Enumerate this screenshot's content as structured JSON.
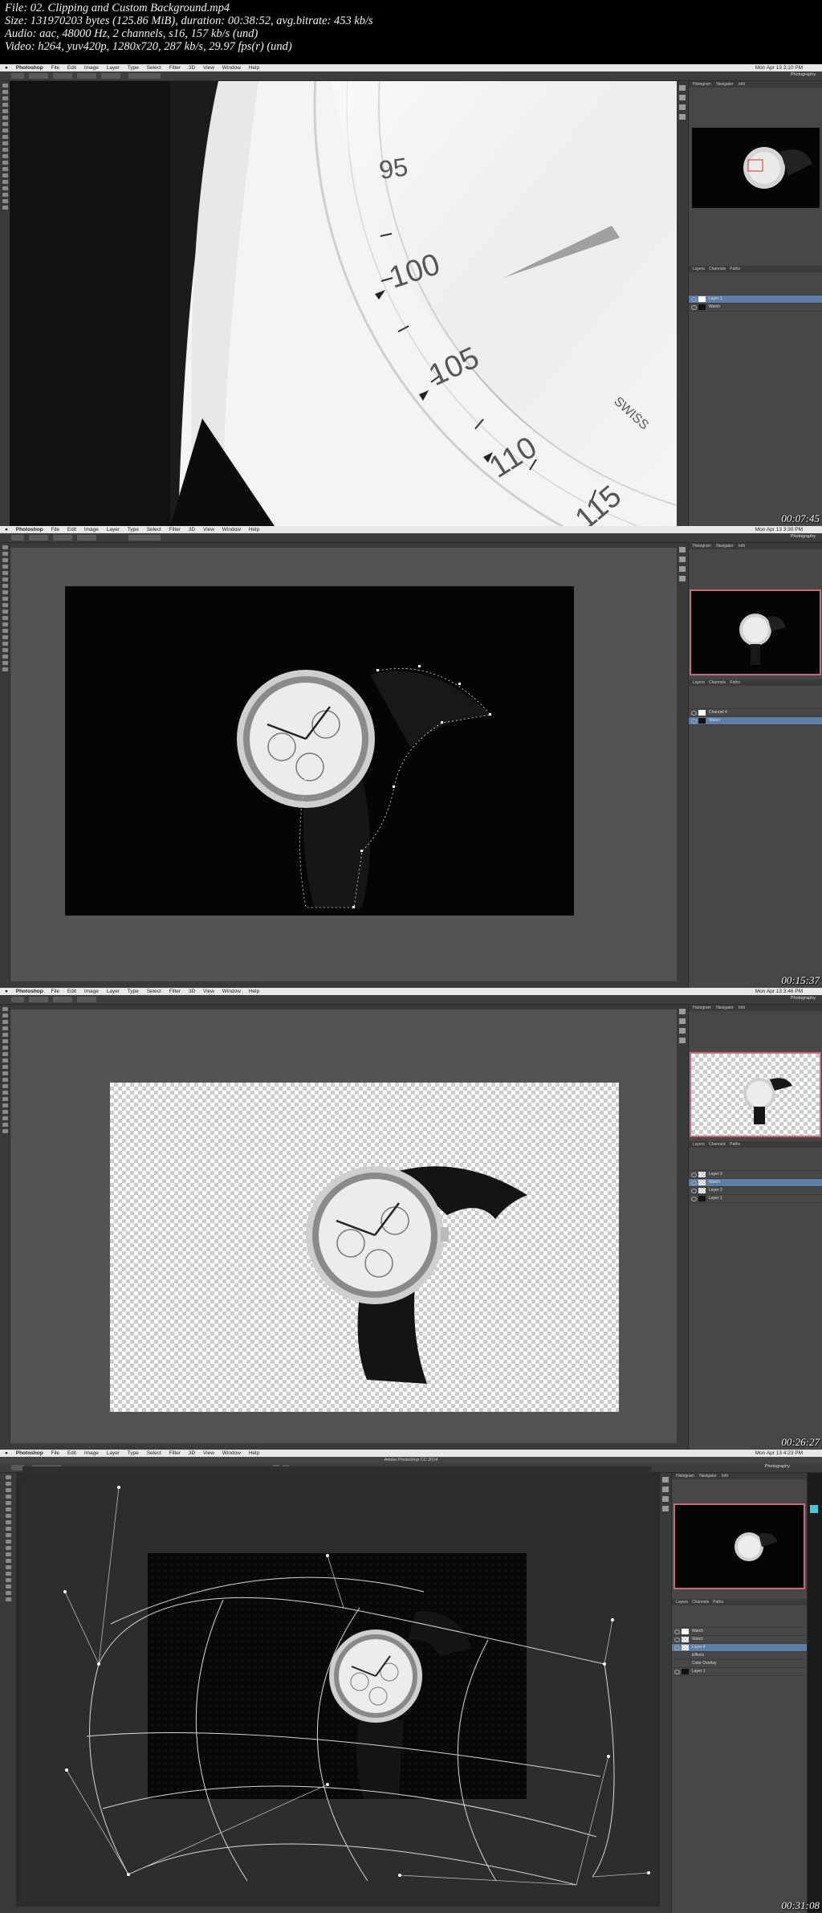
{
  "header": {
    "line1": "File: 02. Clipping and Custom Background.mp4",
    "line2": "Size: 131970203 bytes (125.86 MiB), duration: 00:38:52, avg.bitrate: 453 kb/s",
    "line3": "Audio: aac, 48000 Hz, 2 channels, s16, 157 kb/s (und)",
    "line4": "Video: h264, yuv420p, 1280x720, 287 kb/s, 29.97 fps(r) (und)"
  },
  "menubar": {
    "app": "Photoshop",
    "items": [
      "File",
      "Edit",
      "Image",
      "Layer",
      "Type",
      "Select",
      "Filter",
      "3D",
      "View",
      "Window",
      "Help"
    ]
  },
  "frames": [
    {
      "timestamp": "00:07:45",
      "clock": "Mon Apr 13  3:10 PM",
      "workspace": "Photography",
      "panel_tabs": [
        "Histogram",
        "Navigator",
        "Info"
      ],
      "layers": [
        {
          "name": "Layer 1",
          "active": true
        },
        {
          "name": "Watch",
          "active": false
        }
      ],
      "dial_numbers": [
        "95",
        "100",
        "105",
        "110",
        "115"
      ],
      "dial_text": "SWISS"
    },
    {
      "timestamp": "00:15:37",
      "clock": "Mon Apr 13  3:30 PM",
      "workspace": "Photography",
      "panel_tabs": [
        "Histogram",
        "Navigator",
        "Info"
      ],
      "layers": [
        {
          "name": "Channel 4",
          "active": false
        },
        {
          "name": "Watch",
          "active": true
        }
      ]
    },
    {
      "timestamp": "00:26:27",
      "clock": "Mon Apr 13  3:46 PM",
      "workspace": "Photography",
      "panel_tabs": [
        "Histogram",
        "Navigator",
        "Info"
      ],
      "layers": [
        {
          "name": "Layer 3",
          "active": false
        },
        {
          "name": "Watch",
          "active": true
        },
        {
          "name": "Layer 2",
          "active": false
        },
        {
          "name": "Layer 1",
          "active": false
        }
      ]
    },
    {
      "timestamp": "00:31:08",
      "clock": "Mon Apr 13  4:23 PM",
      "window_title": "Adobe Photoshop CC 2014",
      "workspace": "Photography",
      "panel_tabs": [
        "Histogram",
        "Navigator",
        "Info"
      ],
      "layers": [
        {
          "name": "Watch",
          "active": false
        },
        {
          "name": "Watch",
          "active": false
        },
        {
          "name": "Layer 4",
          "active": true
        },
        {
          "name": "Effects",
          "active": false
        },
        {
          "name": "Color Overlay",
          "active": false
        },
        {
          "name": "Layer 1",
          "active": false
        }
      ]
    }
  ],
  "colors": {
    "workspace_bg": "#535353",
    "panel_bg": "#474747",
    "selection_blue": "#5e7ea8",
    "navigator_red": "#c46a7a"
  }
}
